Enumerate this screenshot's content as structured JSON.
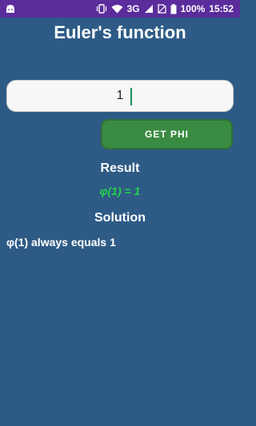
{
  "status_bar": {
    "network": "3G",
    "battery": "100%",
    "time": "15:52",
    "icons": [
      "android-icon",
      "vibrate-icon",
      "wifi-icon",
      "signal-icon",
      "no-sim-icon",
      "battery-icon"
    ]
  },
  "title": "Euler's function",
  "input": {
    "value": "1",
    "placeholder": ""
  },
  "button": {
    "label": "GET PHI"
  },
  "result": {
    "heading": "Result",
    "value": "φ(1) = 1"
  },
  "solution": {
    "heading": "Solution",
    "text": "φ(1) always equals 1"
  },
  "colors": {
    "background": "#2e5b86",
    "status_bar": "#5b2d9c",
    "button": "#3a8b42",
    "result_text": "#22d34a"
  }
}
